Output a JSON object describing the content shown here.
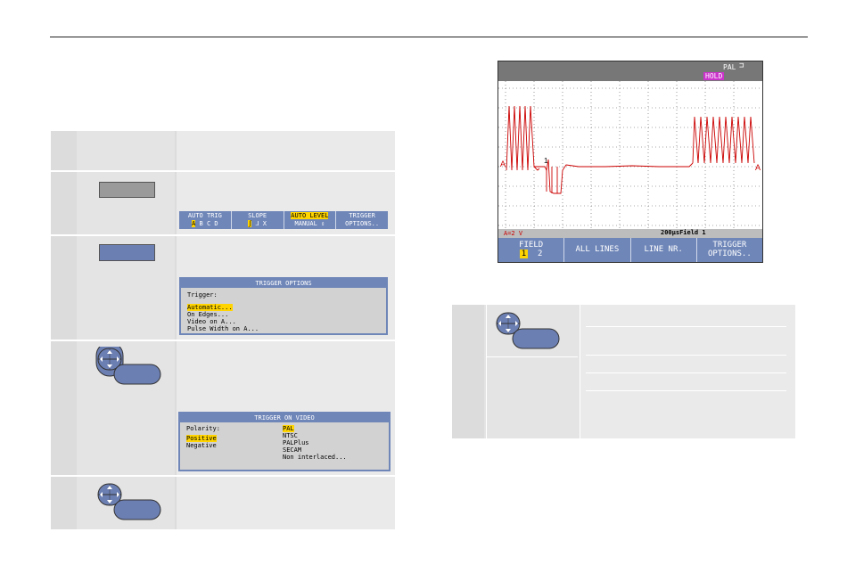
{
  "menus": {
    "trigger_options": {
      "title": "TRIGGER OPTIONS",
      "label": "Trigger:",
      "items": [
        "Automatic...",
        "On Edges...",
        "Video on A...",
        "Pulse Width on A..."
      ]
    },
    "trigger_on_video": {
      "title": "TRIGGER ON VIDEO",
      "polarity_label": "Polarity:",
      "polarity": [
        "Positive",
        "Negative"
      ],
      "standards": [
        "PAL",
        "NTSC",
        "PALPlus",
        "SECAM",
        "Non interlaced..."
      ]
    }
  },
  "softkeys_step2": {
    "auto_trig": {
      "label": "AUTO TRIG",
      "sel": "A",
      "rest": " B C D"
    },
    "slope": {
      "label": "SLOPE",
      "sel": "ʃ",
      "rest": " ⅃  X"
    },
    "auto_level": {
      "label": "AUTO LEVEL",
      "sub": "MANUAL ⇕"
    },
    "trigger_options": {
      "label1": "TRIGGER",
      "label2": "OPTIONS.."
    }
  },
  "scope": {
    "pal": "PAL",
    "hold": "HOLD",
    "status_left": "A=2 V",
    "timebase": "200µs",
    "field_readout": "Field 1",
    "channel_marker": "A",
    "cursor_label": "1",
    "softkeys": {
      "field": {
        "label": "FIELD",
        "sel": "1",
        "rest": "2"
      },
      "all_lines": "ALL LINES",
      "line_nr": "LINE NR.",
      "trigger_options": {
        "label1": "TRIGGER",
        "label2": "OPTIONS.."
      }
    }
  },
  "colors": {
    "menu_blue": "#6f86b8",
    "highlight_yellow": "#ffd400",
    "hold_magenta": "#cc33cc",
    "trace_red": "#cc0000"
  }
}
